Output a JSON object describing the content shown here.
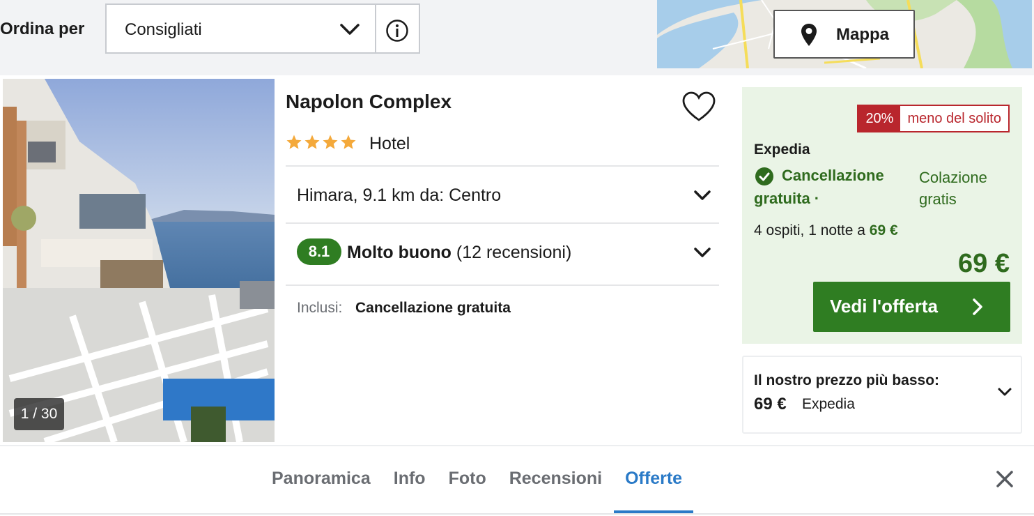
{
  "sort": {
    "label": "Ordina per",
    "selected": "Consigliati"
  },
  "map": {
    "button_label": "Mappa"
  },
  "hotel": {
    "photo_counter": "1 / 30",
    "name": "Napolon Complex",
    "stars": 4,
    "type": "Hotel",
    "location": "Himara, 9.1 km da: Centro",
    "rating_score": "8.1",
    "rating_label": "Molto buono",
    "review_count": "(12 recensioni)",
    "included_label": "Inclusi:",
    "included_value": "Cancellazione gratuita"
  },
  "deal": {
    "discount_pct": "20%",
    "discount_text": "meno del solito",
    "provider": "Expedia",
    "free_cancel_line1": "Cancellazione",
    "free_cancel_line2": "gratuita ·",
    "breakfast": "Colazione gratis",
    "guests_text": "4 ospiti, 1 notte a ",
    "guests_price": "69 €",
    "price": "69 €",
    "cta_label": "Vedi l'offerta"
  },
  "lowest": {
    "label": "Il nostro prezzo più basso:",
    "price": "69 €",
    "provider": "Expedia"
  },
  "tabs": [
    {
      "label": "Panoramica",
      "active": false
    },
    {
      "label": "Info",
      "active": false
    },
    {
      "label": "Foto",
      "active": false
    },
    {
      "label": "Recensioni",
      "active": false
    },
    {
      "label": "Offerte",
      "active": true
    }
  ],
  "colors": {
    "green": "#2f7d22",
    "red": "#b9262d",
    "blue": "#2a7ac7",
    "star": "#f4a93b"
  }
}
